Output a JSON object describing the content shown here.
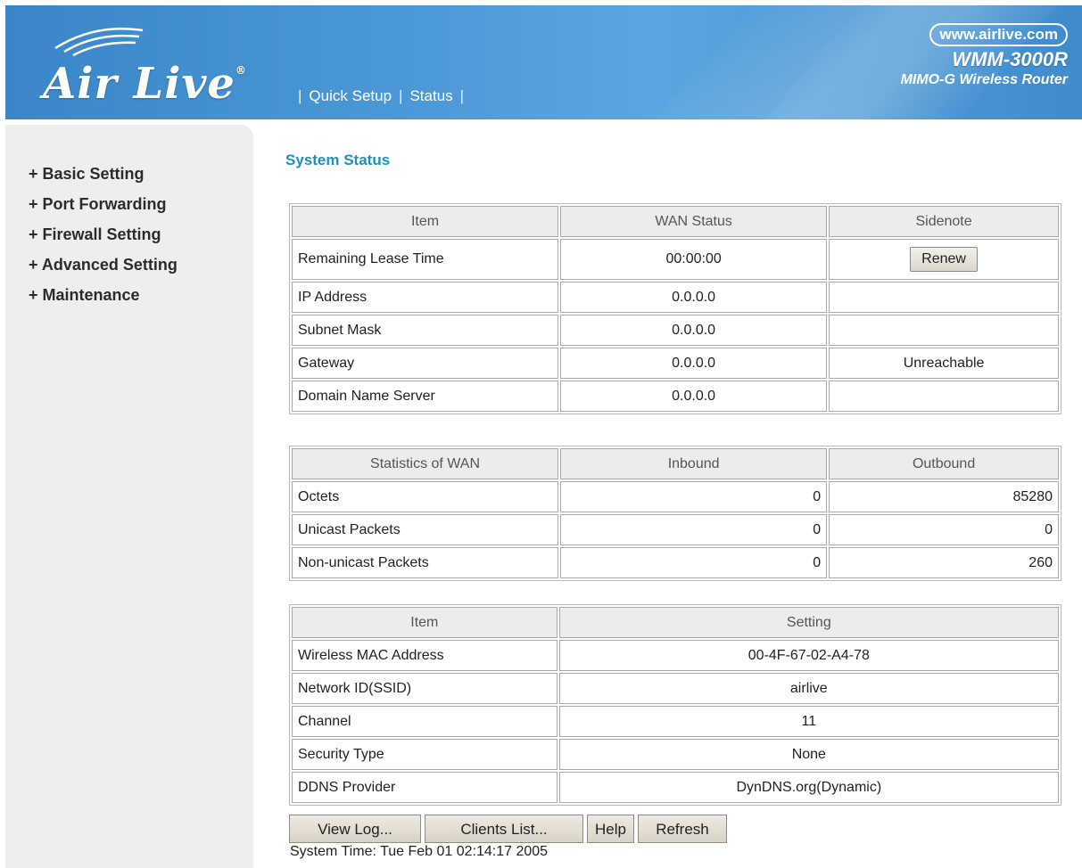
{
  "header": {
    "logo_text": "Air Live",
    "logo_mark": "®",
    "nav": [
      "Quick Setup",
      "Status"
    ],
    "brand_url": "www.airlive.com",
    "model": "WMM-3000R",
    "description": "MIMO-G Wireless Router"
  },
  "sidebar": {
    "items": [
      {
        "label": "+ Basic Setting"
      },
      {
        "label": "+ Port Forwarding"
      },
      {
        "label": "+ Firewall Setting"
      },
      {
        "label": "+ Advanced Setting"
      },
      {
        "label": "+ Maintenance"
      }
    ]
  },
  "main": {
    "title": "System Status",
    "wan_table": {
      "headers": [
        "Item",
        "WAN Status",
        "Sidenote"
      ],
      "rows": [
        {
          "item": "Remaining Lease Time",
          "status": "00:00:00",
          "note": ""
        },
        {
          "item": "IP Address",
          "status": "0.0.0.0",
          "note": ""
        },
        {
          "item": "Subnet Mask",
          "status": "0.0.0.0",
          "note": ""
        },
        {
          "item": "Gateway",
          "status": "0.0.0.0",
          "note": "Unreachable"
        },
        {
          "item": "Domain Name Server",
          "status": "0.0.0.0",
          "note": ""
        }
      ],
      "renew_label": "Renew"
    },
    "stats_table": {
      "headers": [
        "Statistics of WAN",
        "Inbound",
        "Outbound"
      ],
      "rows": [
        {
          "name": "Octets",
          "inbound": "0",
          "outbound": "85280"
        },
        {
          "name": "Unicast Packets",
          "inbound": "0",
          "outbound": "0"
        },
        {
          "name": "Non-unicast Packets",
          "inbound": "0",
          "outbound": "260"
        }
      ]
    },
    "settings_table": {
      "headers": [
        "Item",
        "Setting"
      ],
      "rows": [
        {
          "item": "Wireless MAC Address",
          "value": "00-4F-67-02-A4-78"
        },
        {
          "item": "Network ID(SSID)",
          "value": "airlive"
        },
        {
          "item": "Channel",
          "value": "11"
        },
        {
          "item": "Security Type",
          "value": "None"
        },
        {
          "item": "DDNS Provider",
          "value": "DynDNS.org(Dynamic)"
        }
      ]
    },
    "buttons": {
      "view_log": "View Log...",
      "clients_list": "Clients List...",
      "help": "Help",
      "refresh": "Refresh"
    },
    "system_time": "System Time: Tue Feb 01 02:14:17 2005"
  }
}
